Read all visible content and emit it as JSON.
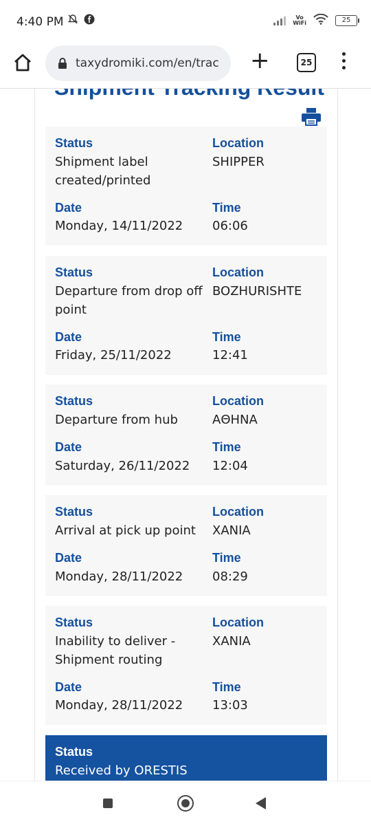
{
  "status_bar": {
    "time": "4:40 PM",
    "vowifi_top": "Vo",
    "vowifi_bottom": "WiFi",
    "battery": "25"
  },
  "browser": {
    "url": "taxydromiki.com/en/trac",
    "tab_count": "25"
  },
  "page": {
    "title": "Shipment Tracking Result",
    "labels": {
      "status": "Status",
      "location": "Location",
      "date": "Date",
      "time": "Time"
    },
    "events": [
      {
        "status": "Shipment label created/printed",
        "location": "SHIPPER",
        "date": "Monday, 14/11/2022",
        "time": "06:06"
      },
      {
        "status": "Departure from drop off point",
        "location": "BOZHURISHTE",
        "date": "Friday, 25/11/2022",
        "time": "12:41"
      },
      {
        "status": "Departure from hub",
        "location": "ΑΘΗΝΑ",
        "date": "Saturday, 26/11/2022",
        "time": "12:04"
      },
      {
        "status": "Arrival at pick up point",
        "location": "XANIA",
        "date": "Monday, 28/11/2022",
        "time": "08:29"
      },
      {
        "status": "Inability to deliver - Shipment routing",
        "location": "XANIA",
        "date": "Monday, 28/11/2022",
        "time": "13:03"
      },
      {
        "status": "Received by ORESTIS",
        "location": "",
        "date": "",
        "time": ""
      }
    ]
  },
  "colors": {
    "accent": "#15509c",
    "card_bg": "#f7f7f7",
    "highlight_bg": "#1552a0"
  }
}
